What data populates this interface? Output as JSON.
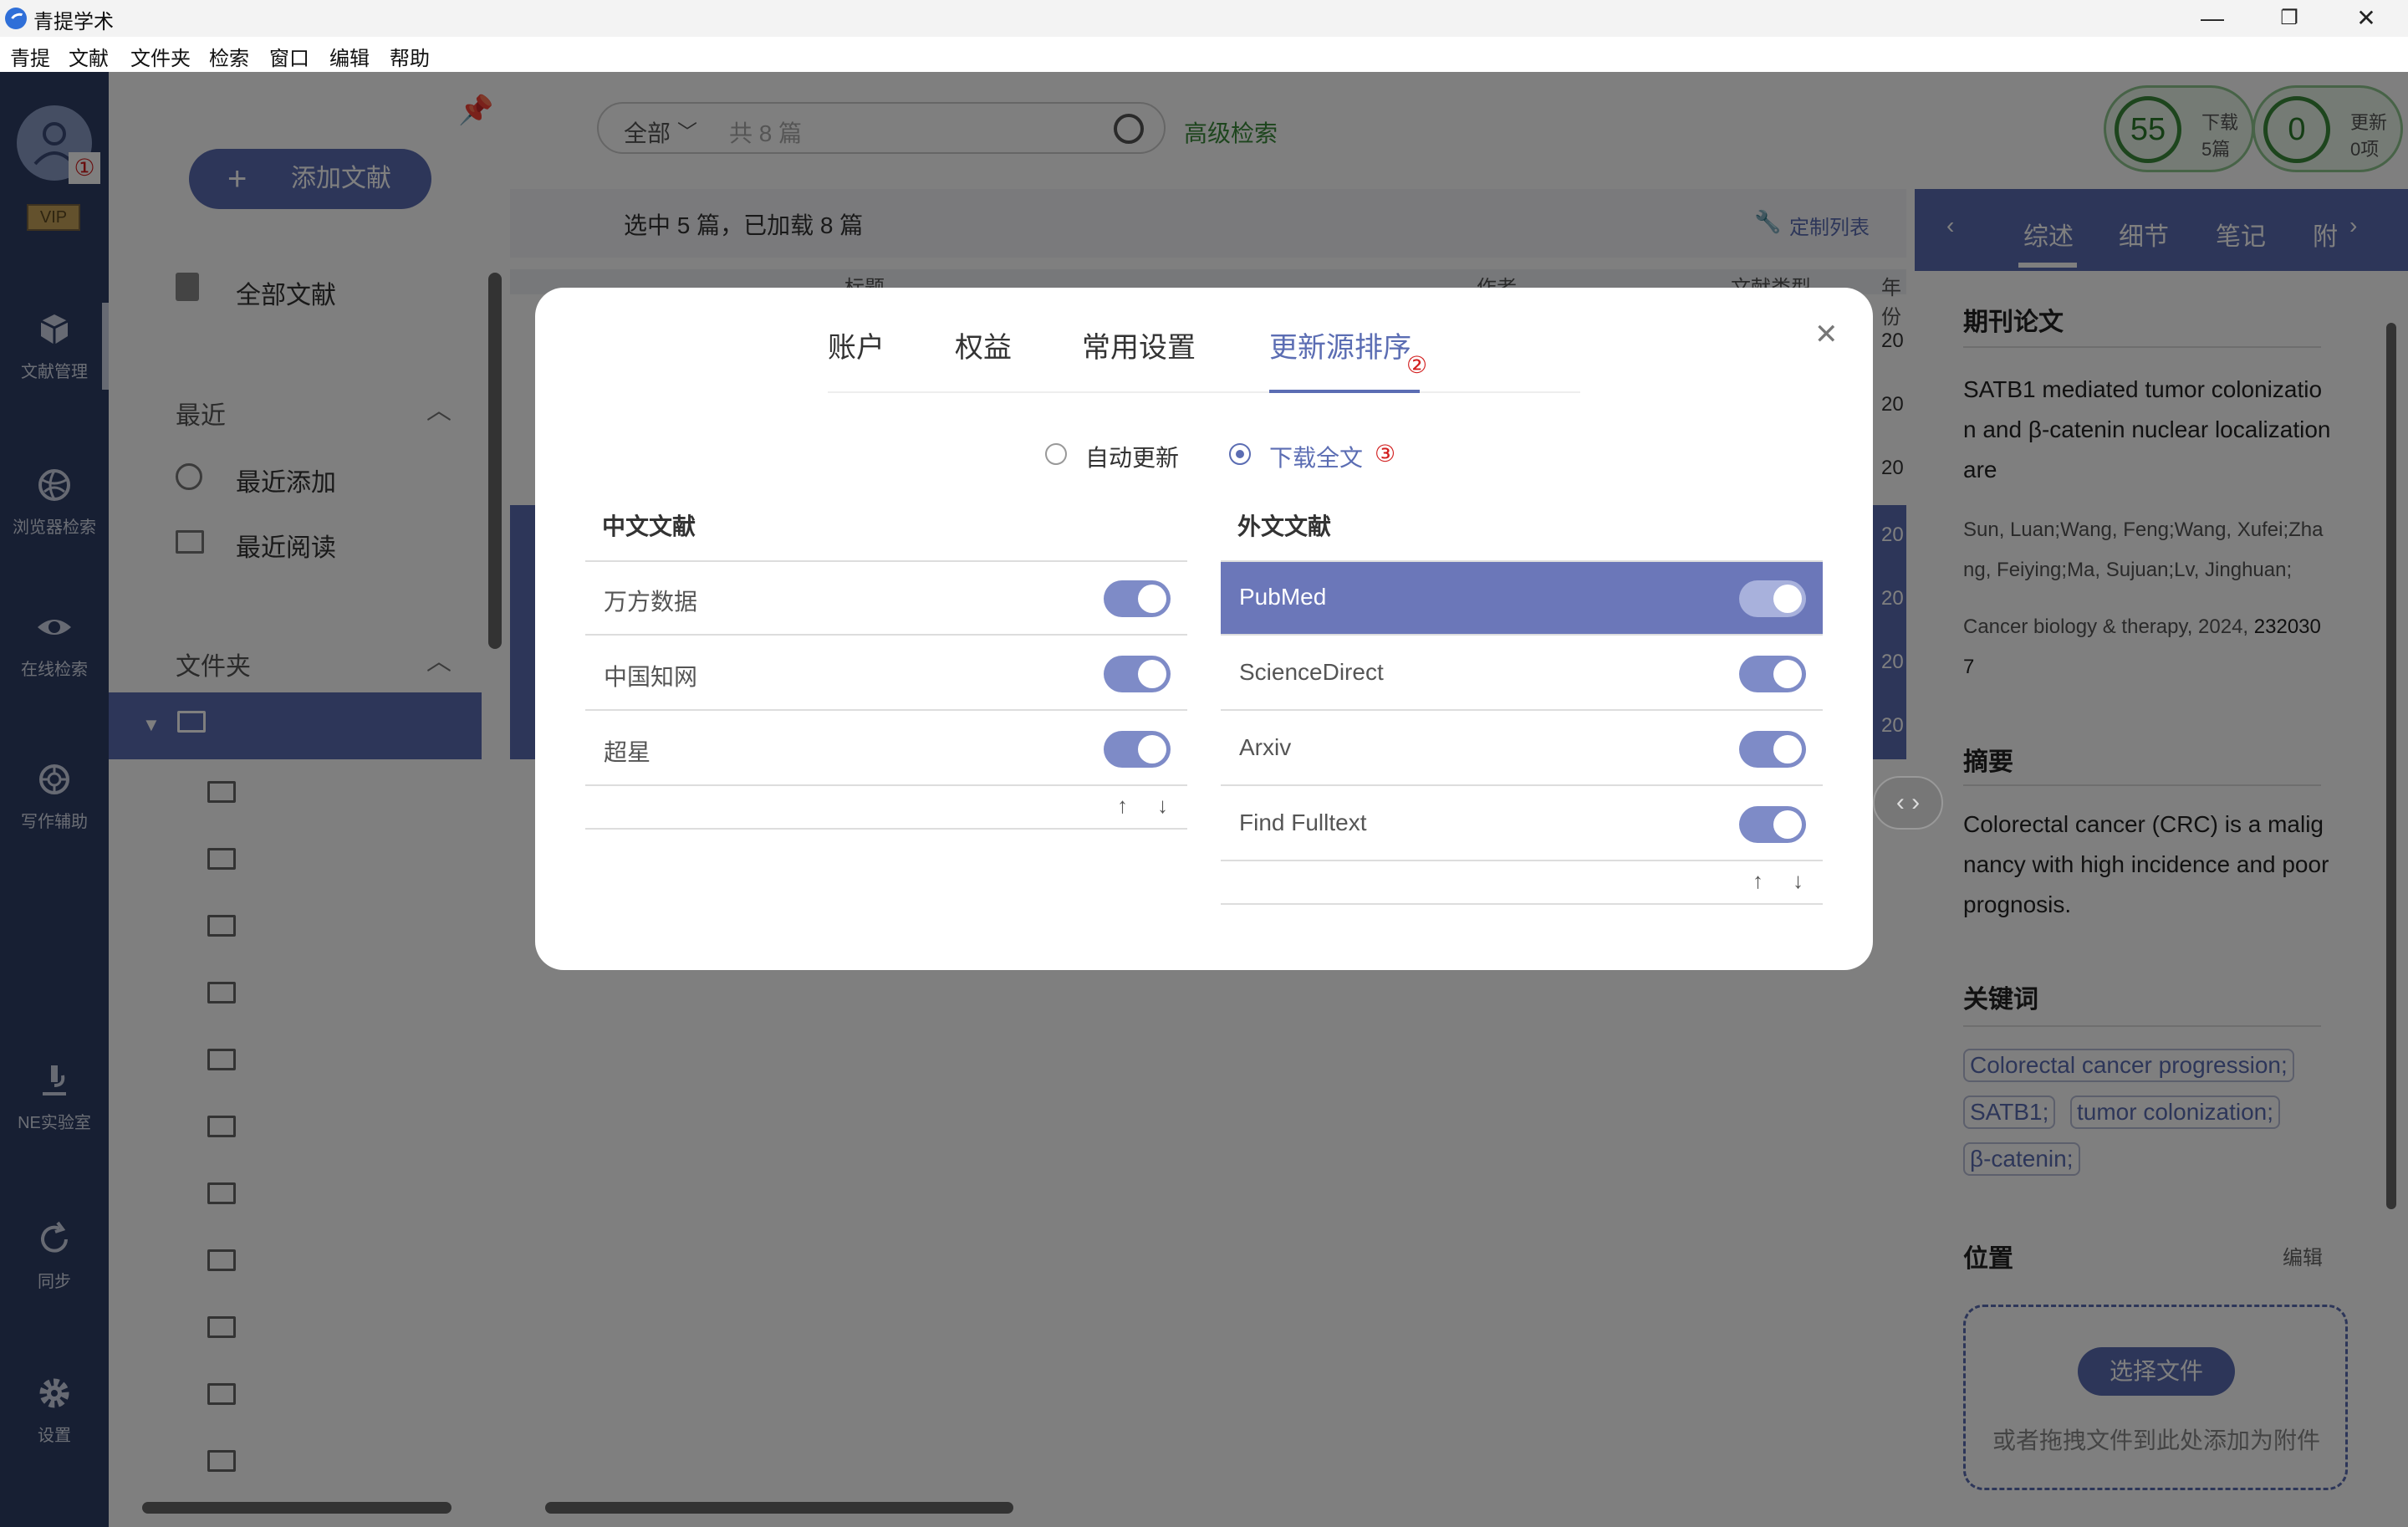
{
  "window": {
    "title": "青提学术",
    "minimize": "—",
    "maximize": "❐",
    "close": "✕"
  },
  "menu": [
    "青提",
    "文献",
    "文件夹",
    "检索",
    "窗口",
    "编辑",
    "帮助"
  ],
  "nav": {
    "vip": "VIP",
    "items": [
      {
        "label": "文献管理",
        "icon": "cube-icon"
      },
      {
        "label": "浏览器检索",
        "icon": "globe-icon"
      },
      {
        "label": "在线检索",
        "icon": "eye-icon"
      },
      {
        "label": "写作辅助",
        "icon": "ai-icon"
      },
      {
        "label": "NE实验室",
        "icon": "microscope-icon"
      },
      {
        "label": "同步",
        "icon": "sync-icon"
      },
      {
        "label": "设置",
        "icon": "gear-icon"
      }
    ]
  },
  "panel": {
    "add_button": "添加文献",
    "all_docs": "全部文献",
    "recent_header": "最近",
    "recent_add": "最近添加",
    "recent_read": "最近阅读",
    "folder_header": "文件夹"
  },
  "main": {
    "search_scope": "全部",
    "search_placeholder": "共 8 篇",
    "advanced": "高级检索",
    "status": "选中 5 篇，已加载 8 篇",
    "customize": "定制列表",
    "col_title": "标题",
    "col_author": "作者",
    "col_type": "文献类型",
    "col_year": "年份",
    "year_cells": [
      "20",
      "20",
      "20",
      "20",
      "20",
      "20",
      "20"
    ]
  },
  "stats": {
    "download_count": "55",
    "download_label": "下载",
    "download_sub": "5篇",
    "update_count": "0",
    "update_label": "更新",
    "update_sub": "0项"
  },
  "right": {
    "tabs": [
      "综述",
      "细节",
      "笔记",
      "附"
    ],
    "type": "期刊论文",
    "title": "SATB1 mediated tumor colonization and β-catenin nuclear localization are",
    "authors": "Sun, Luan;Wang, Feng;Wang, Xufei;Zhang, Feiying;Ma, Sujuan;Lv, Jinghuan;",
    "journal": "Cancer biology & therapy, 2024,",
    "journal_id": "2320307",
    "abstract_header": "摘要",
    "abstract": "Colorectal cancer (CRC) is a malignancy with high incidence and poor prognosis.",
    "keywords_header": "关键词",
    "keywords": [
      "Colorectal cancer progression;",
      "SATB1;",
      "tumor colonization;",
      "β-catenin;"
    ],
    "location_header": "位置",
    "edit": "编辑",
    "choose_file": "选择文件",
    "drop_hint": "或者拖拽文件到此处添加为附件"
  },
  "modal": {
    "tabs": [
      "账户",
      "权益",
      "常用设置",
      "更新源排序"
    ],
    "mark_avatar": "①",
    "mark_tab": "②",
    "mark_radio": "③",
    "radio_auto": "自动更新",
    "radio_download": "下载全文",
    "zh_header": "中文文献",
    "en_header": "外文文献",
    "zh_sources": [
      "万方数据",
      "中国知网",
      "超星"
    ],
    "en_sources": [
      "PubMed",
      "ScienceDirect",
      "Arxiv",
      "Find Fulltext"
    ],
    "close": "✕",
    "up": "↑",
    "down": "↓"
  },
  "colors": {
    "accent": "#5b6db3",
    "nav_bg": "#2f3f67",
    "selected_row": "#6b77b9",
    "annotation": "#d21f1f"
  }
}
